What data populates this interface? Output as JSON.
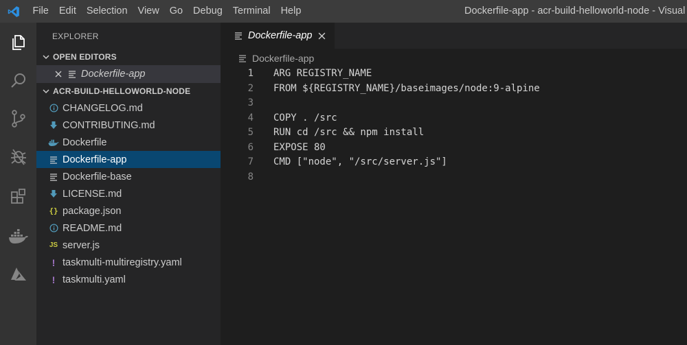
{
  "titlebar": {
    "menu": [
      "File",
      "Edit",
      "Selection",
      "View",
      "Go",
      "Debug",
      "Terminal",
      "Help"
    ],
    "window_title": "Dockerfile-app - acr-build-helloworld-node - Visual St"
  },
  "activity_bar": {
    "icons": [
      "explorer-icon",
      "search-icon",
      "source-control-icon",
      "debug-icon",
      "extensions-icon",
      "docker-icon",
      "azure-icon"
    ]
  },
  "sidebar": {
    "title": "EXPLORER",
    "open_editors": {
      "header": "OPEN EDITORS",
      "items": [
        {
          "label": "Dockerfile-app"
        }
      ]
    },
    "folder": {
      "header": "ACR-BUILD-HELLOWORLD-NODE",
      "files": [
        {
          "label": "CHANGELOG.md",
          "icon": "info-icon",
          "color": "#519aba"
        },
        {
          "label": "CONTRIBUTING.md",
          "icon": "markdown-download-icon",
          "color": "#519aba"
        },
        {
          "label": "Dockerfile",
          "icon": "docker-whale-icon",
          "color": "#519aba"
        },
        {
          "label": "Dockerfile-app",
          "icon": "text-lines-icon",
          "color": "#cccccc",
          "selected": true
        },
        {
          "label": "Dockerfile-base",
          "icon": "text-lines-icon",
          "color": "#cccccc"
        },
        {
          "label": "LICENSE.md",
          "icon": "markdown-download-icon",
          "color": "#519aba"
        },
        {
          "label": "package.json",
          "icon": "json-braces-icon",
          "color": "#cbcb41"
        },
        {
          "label": "README.md",
          "icon": "info-icon",
          "color": "#519aba"
        },
        {
          "label": "server.js",
          "icon": "javascript-icon",
          "color": "#cbcb41"
        },
        {
          "label": "taskmulti-multiregistry.yaml",
          "icon": "yaml-exclamation-icon",
          "color": "#a074c4"
        },
        {
          "label": "taskmulti.yaml",
          "icon": "yaml-exclamation-icon",
          "color": "#a074c4"
        }
      ]
    }
  },
  "editor": {
    "tab": {
      "label": "Dockerfile-app"
    },
    "breadcrumb": "Dockerfile-app",
    "active_line": 1,
    "lines": [
      "ARG REGISTRY_NAME",
      "FROM ${REGISTRY_NAME}/baseimages/node:9-alpine",
      "",
      "COPY . /src",
      "RUN cd /src && npm install",
      "EXPOSE 80",
      "CMD [\"node\", \"/src/server.js\"]",
      ""
    ]
  },
  "colors": {
    "accent_blue": "#007acc",
    "selection": "#094771",
    "title_bar": "#3c3c3c",
    "activity_bar": "#333333",
    "sidebar": "#252526",
    "editor": "#1e1e1e"
  }
}
